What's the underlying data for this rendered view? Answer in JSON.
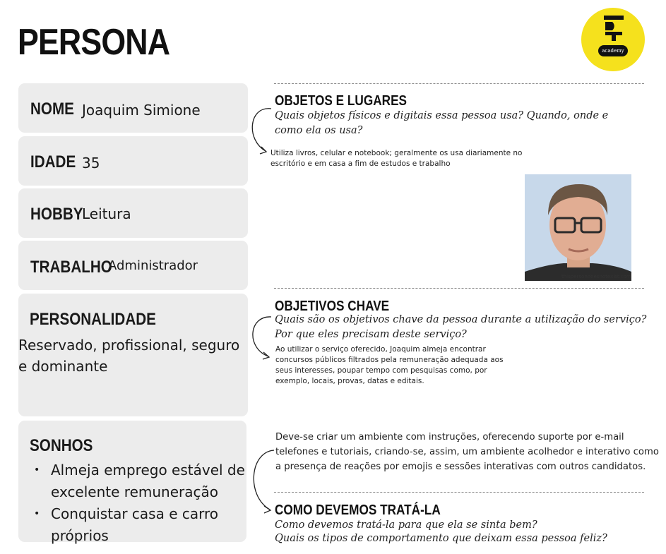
{
  "title": "PERSONA",
  "logo": {
    "mark": "DT",
    "text": "academy",
    "color": "#f5e11d"
  },
  "fields": {
    "nome": {
      "label": "NOME",
      "value": "Joaquim Simione"
    },
    "idade": {
      "label": "IDADE",
      "value": "35"
    },
    "hobby": {
      "label": "HOBBY",
      "value": "Leitura"
    },
    "trabalho": {
      "label": "TRABALHO",
      "value": "Administrador"
    },
    "personalidade": {
      "label": "PERSONALIDADE",
      "value": "Reservado, profissional, seguro e dominante"
    },
    "sonhos": {
      "label": "SONHOS",
      "items": [
        "Almeja emprego estável de excelente remuneração",
        "Conquistar casa e carro próprios"
      ]
    }
  },
  "sections": {
    "objetos": {
      "title": "OBJETOS E LUGARES",
      "question": "Quais objetos físicos e digitais essa pessoa usa? Quando, onde e como ela os usa?",
      "answer": "Utiliza livros, celular e notebook; geralmente os usa diariamente no escritório e em casa a fim de estudos e trabalho"
    },
    "objetivos": {
      "title": "OBJETIVOS CHAVE",
      "question": "Quais são os objetivos chave da pessoa durante a utilização do serviço? Por que eles precisam deste serviço?",
      "answer": "Ao utilizar o serviço oferecido, Joaquim almeja encontrar concursos públicos filtrados pela remuneração adequada aos seus interesses, poupar tempo com pesquisas como, por exemplo, locais, provas, datas e editais."
    },
    "tratamento": {
      "title": "COMO DEVEMOS TRATÁ-LA",
      "question_line1": "Como devemos tratá-la para que ela se sinta bem?",
      "question_line2": "Quais os tipos de comportamento que deixam essa pessoa feliz?",
      "answer": "Deve-se criar um ambiente com instruções, oferecendo suporte por e-mail telefones e tutoriais, criando-se, assim, um ambiente acolhedor e interativo como a presença de reações por emojis e sessões interativas com outros candidatos."
    }
  },
  "photo": {
    "credit": "thispersondoesnotexist.com"
  }
}
